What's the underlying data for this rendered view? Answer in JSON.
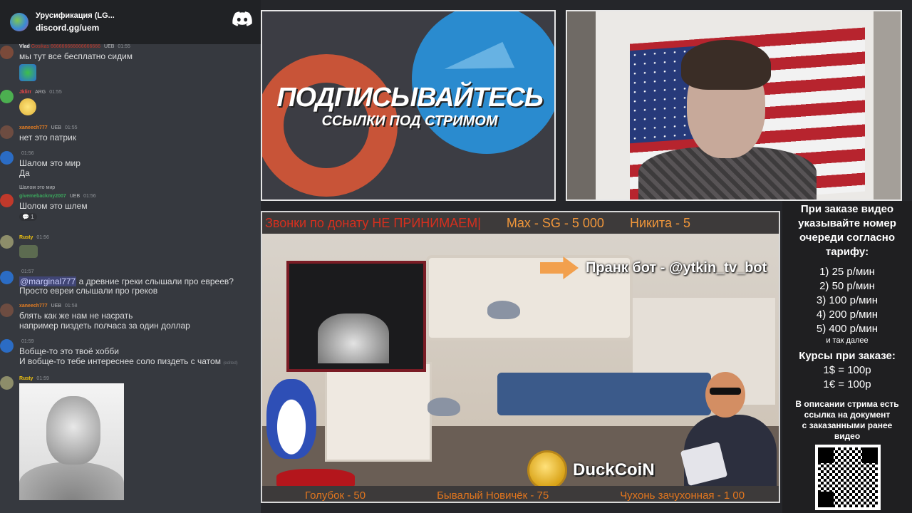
{
  "discord": {
    "server_name": "Урусификация (LG...",
    "invite": "discord.gg/uem"
  },
  "chat": [
    {
      "user": "Vlad",
      "user_rest": "Gosikas 666666666666666666",
      "badge": "UEB",
      "time": "01:55",
      "text": "мы тут все бесплатно сидим",
      "user_color": "#e8e8e8"
    },
    {
      "user": "Jklirr",
      "badge": "ARG",
      "time": "01:55",
      "text": "",
      "user_color": "#f04747"
    },
    {
      "user": "xaneech777",
      "badge": "UEB",
      "time": "01:55",
      "text": "нет это патрик",
      "user_color": "#e67e22"
    },
    {
      "user": "",
      "badge": "",
      "time": "01:56",
      "text": "Шалом это мир",
      "text2": "Да",
      "user_color": "#f1c40f"
    },
    {
      "reply": "Шалом это мир",
      "user": "givemebackmy2007",
      "badge": "UEB",
      "time": "01:56",
      "text": "Шолом это шлем",
      "reaction": "1",
      "user_color": "#3ba55c"
    },
    {
      "user": "Rusty",
      "badge": "",
      "time": "01:56",
      "text": "",
      "user_color": "#f1c40f"
    },
    {
      "user": "",
      "badge": "",
      "time": "01:57",
      "mention": "@marginal777",
      "text": " а древние греки слышали про евреев?",
      "text2": "Просто евреи слышали про греков",
      "user_color": "#f1c40f"
    },
    {
      "user": "xaneech777",
      "badge": "UEB",
      "time": "01:58",
      "text": "блять как же нам не насрать",
      "text2": "например пиздеть полчаса за один доллар",
      "user_color": "#e67e22"
    },
    {
      "user": "",
      "badge": "",
      "time": "01:59",
      "text": "Вобще-то это твоё хобби",
      "text2": "И вобще-то тебе интереснее соло пиздеть с чатом",
      "edited": "(edited)",
      "user_color": "#f1c40f"
    },
    {
      "user": "Rusty",
      "badge": "",
      "time": "01:59",
      "text": "",
      "user_color": "#f1c40f"
    }
  ],
  "banner": {
    "title": "ПОДПИСЫВАЙТЕСЬ",
    "subtitle": "ССЫЛКИ ПОД СТРИМОМ"
  },
  "stream": {
    "ticker_red": "Звонки по донату НЕ ПРИНИМАЕМ|",
    "ticker_1": "Max - SG - 5 000",
    "ticker_2": "Никита - 5",
    "prank": "Пранк бот - @ytkin_tv_bot",
    "duck": "DuckCoiN",
    "bottom_1": "Голубок - 50",
    "bottom_2": "Бывалый Новичёк - 75",
    "bottom_3": "Чухонь зачухонная - 1 00"
  },
  "info": {
    "lines": [
      "При заказе видео",
      "указывайте номер",
      "очереди согласно",
      "тарифу:"
    ],
    "tariffs": [
      "1) 25 р/мин",
      "2) 50 р/мин",
      "3) 100 р/мин",
      "4) 200 р/мин",
      "5) 400 р/мин"
    ],
    "tariff_note": "и так далее",
    "rates_head": "Курсы при заказе:",
    "rates": [
      "1$ = 100р",
      "1€ = 100р"
    ],
    "desc": [
      "В описании стрима есть",
      "ссылка на документ",
      "с заказанными ранее",
      "видео"
    ]
  }
}
